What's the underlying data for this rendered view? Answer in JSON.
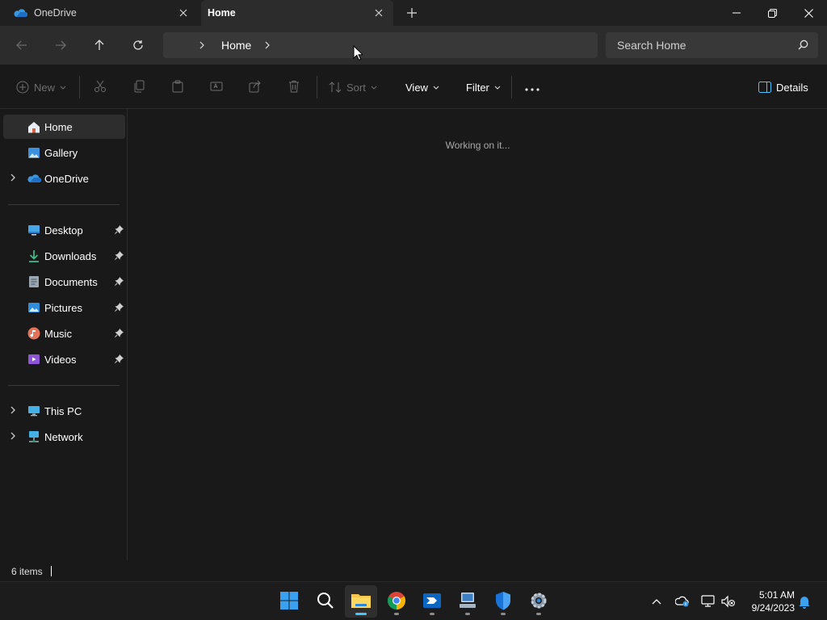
{
  "window": {
    "tabs": [
      {
        "label": "OneDrive",
        "icon": "onedrive-cloud-icon",
        "active": false
      },
      {
        "label": "Home",
        "icon": "home-icon",
        "active": true
      }
    ]
  },
  "address": {
    "crumbs": [
      "Home"
    ],
    "search_placeholder": "Search Home"
  },
  "commands": {
    "new": "New",
    "sort": "Sort",
    "view": "View",
    "filter": "Filter",
    "details": "Details"
  },
  "sidebar": {
    "items": [
      {
        "label": "Home",
        "icon": "home-icon",
        "selected": true
      },
      {
        "label": "Gallery",
        "icon": "gallery-icon"
      },
      {
        "label": "OneDrive",
        "icon": "onedrive-cloud-icon",
        "expandable": true
      },
      {
        "label": "Desktop",
        "icon": "desktop-icon",
        "pinned": true
      },
      {
        "label": "Downloads",
        "icon": "downloads-icon",
        "pinned": true
      },
      {
        "label": "Documents",
        "icon": "documents-icon",
        "pinned": true
      },
      {
        "label": "Pictures",
        "icon": "pictures-icon",
        "pinned": true
      },
      {
        "label": "Music",
        "icon": "music-icon",
        "pinned": true
      },
      {
        "label": "Videos",
        "icon": "videos-icon",
        "pinned": true
      },
      {
        "label": "This PC",
        "icon": "this-pc-icon",
        "expandable": true
      },
      {
        "label": "Network",
        "icon": "network-icon",
        "expandable": true
      }
    ]
  },
  "content": {
    "status_message": "Working on it..."
  },
  "statusbar": {
    "item_count": "6 items"
  },
  "taskbar": {
    "apps": [
      "start-icon",
      "search-icon",
      "file-explorer-icon",
      "chrome-icon",
      "power-automate-icon",
      "remote-desktop-icon",
      "defender-icon",
      "settings-icon"
    ],
    "clock_time": "5:01 AM",
    "clock_date": "9/24/2023"
  },
  "colors": {
    "accent": "#4cc2ff",
    "background": "#191919",
    "chrome": "#2c2c2c"
  }
}
